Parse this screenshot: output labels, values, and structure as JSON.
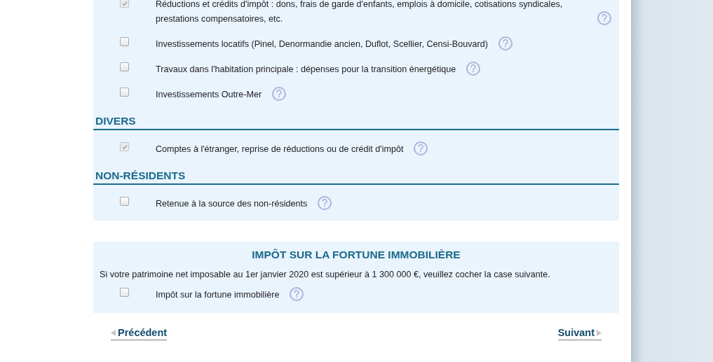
{
  "sections": [
    {
      "items": [
        {
          "label": "Réductions et crédits d'impôt : dons, frais de garde d'enfants, emplois à domicile, cotisations syndicales, prestations compensatoires, etc.",
          "checked": true,
          "disabled": true
        },
        {
          "label": "Investissements locatifs (Pinel, Denormandie ancien, Duflot, Scellier, Censi-Bouvard)",
          "checked": false,
          "disabled": false
        },
        {
          "label": "Travaux dans l'habitation principale : dépenses pour la transition énergétique",
          "checked": false,
          "disabled": false
        },
        {
          "label": "Investissements Outre-Mer",
          "checked": false,
          "disabled": false
        }
      ]
    },
    {
      "heading": "DIVERS",
      "items": [
        {
          "label": "Comptes à l'étranger, reprise de réductions ou de crédit d'impôt",
          "checked": true,
          "disabled": true
        }
      ]
    },
    {
      "heading": "NON-RÉSIDENTS",
      "items": [
        {
          "label": "Retenue à la source des non-résidents",
          "checked": false,
          "disabled": false
        }
      ]
    }
  ],
  "ifi": {
    "title": "IMPÔT SUR LA FORTUNE IMMOBILIÈRE",
    "text": "Si votre patrimoine net imposable au 1er janvier 2020 est supérieur à 1 300 000 €, veuillez cocher la case suivante.",
    "item": {
      "label": "Impôt sur la fortune immobilière",
      "checked": false,
      "disabled": false
    }
  },
  "nav": {
    "previous": "Précédent",
    "next": "Suivant"
  }
}
